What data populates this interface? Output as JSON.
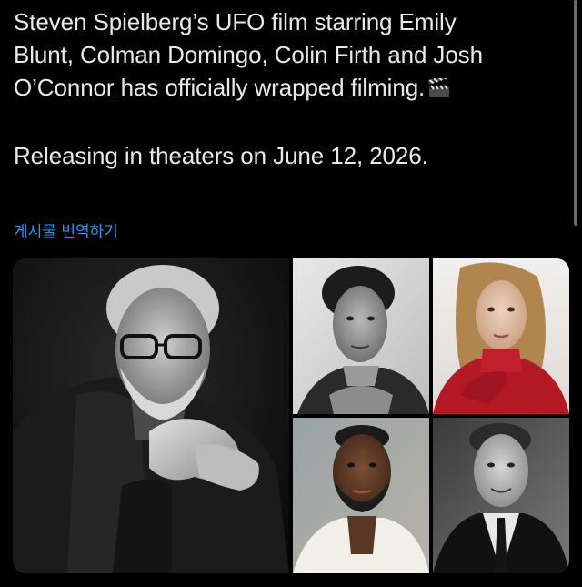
{
  "post": {
    "text_line1": "Steven Spielberg’s UFO film starring Emily\nBlunt, Colman Domingo, Colin Firth and Josh\nO’Connor has officially wrapped filming.",
    "text_line2": "Releasing in theaters on June 12, 2026.",
    "emoji_icon": "clapper-board-icon",
    "translate_label": "게시물 번역하기"
  },
  "media": {
    "photos": [
      {
        "subject": "Steven Spielberg portrait",
        "style": "black-and-white"
      },
      {
        "subject": "Josh O’Connor portrait",
        "style": "black-and-white"
      },
      {
        "subject": "Emily Blunt portrait",
        "style": "color, red turtleneck"
      },
      {
        "subject": "Colman Domingo portrait",
        "style": "color, white shirt"
      },
      {
        "subject": "Colin Firth portrait",
        "style": "black-and-white, suit"
      }
    ]
  },
  "colors": {
    "background": "#000000",
    "text": "#e7e9ea",
    "link": "#1d9bf0"
  }
}
